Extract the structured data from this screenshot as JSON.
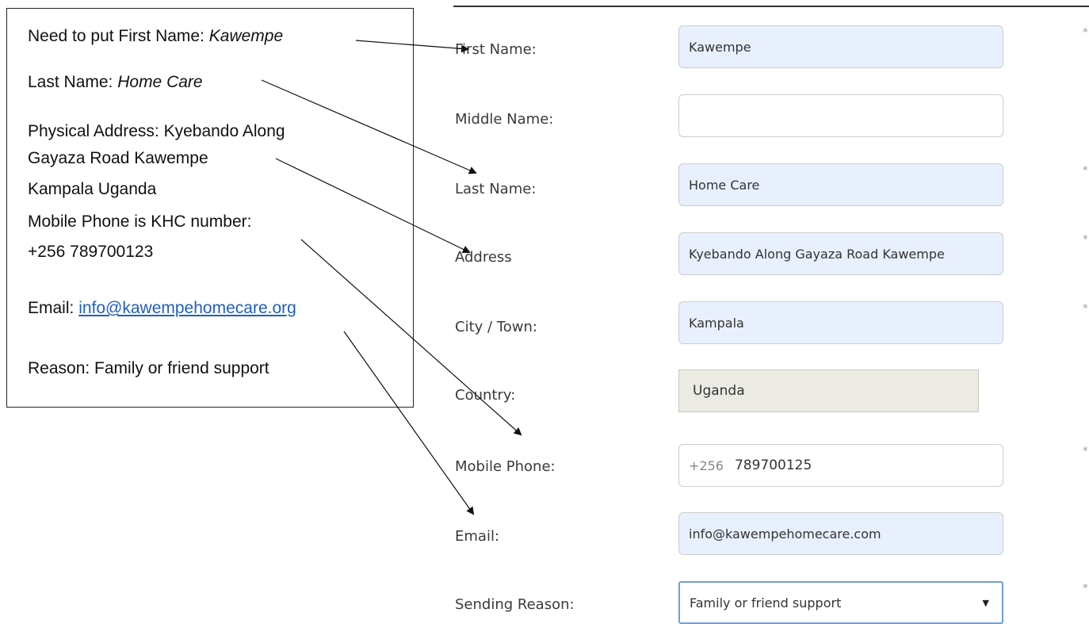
{
  "note": {
    "line1_prefix": "Need to put First Name:  ",
    "line1_value": "Kawempe",
    "line2_prefix": "Last Name:  ",
    "line2_value": "Home Care",
    "line3": "Physical Address: Kyebando Along",
    "line4": "Gayaza Road Kawempe",
    "line5": "Kampala Uganda",
    "line6": "Mobile Phone is KHC number:",
    "line7": " +256 789700123",
    "email_prefix": "Email: ",
    "email_link": "info@kawempehomecare.org",
    "reason": "Reason: Family or friend support"
  },
  "form": {
    "first_name": {
      "label": "First Name:",
      "value": "Kawempe"
    },
    "middle_name": {
      "label": "Middle Name:",
      "value": ""
    },
    "last_name": {
      "label": "Last Name:",
      "value": "Home Care"
    },
    "address": {
      "label": "Address",
      "value": "Kyebando Along Gayaza Road Kawempe"
    },
    "city": {
      "label": "City / Town:",
      "value": "Kampala"
    },
    "country": {
      "label": "Country:",
      "value": "Uganda"
    },
    "mobile": {
      "label": "Mobile Phone:",
      "prefix": "+256",
      "value": "789700125"
    },
    "email": {
      "label": "Email:",
      "value": "info@kawempehomecare.com"
    },
    "reason": {
      "label": "Sending Reason:",
      "value": "Family or friend support"
    },
    "required_marker": "*"
  },
  "icons": {
    "select_caret": "triangle-down-icon"
  }
}
